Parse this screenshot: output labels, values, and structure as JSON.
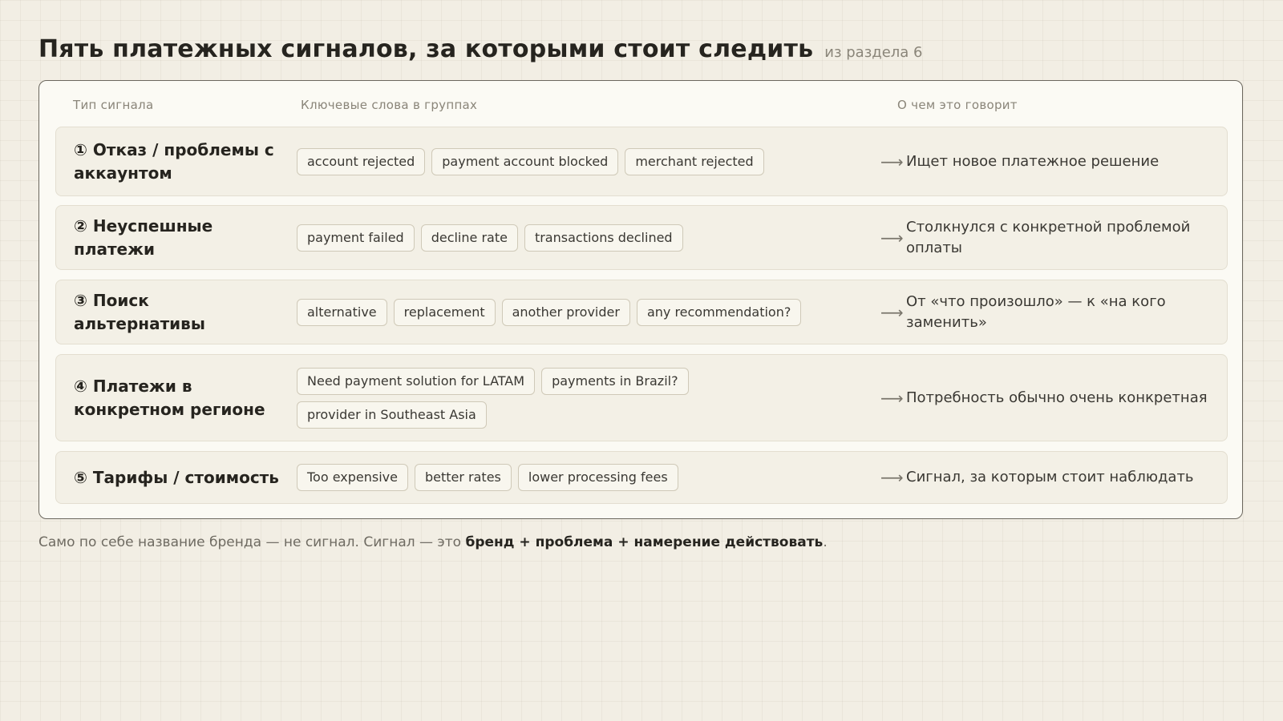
{
  "header": {
    "title": "Пять платежных сигналов, за которыми стоит следить",
    "subtitle": "из раздела 6"
  },
  "table": {
    "columns": [
      "Тип сигнала",
      "Ключевые слова в группах",
      "О чем это говорит"
    ],
    "rows": [
      {
        "type": "① Отказ / проблемы с аккаунтом",
        "keywords": [
          "account rejected",
          "payment account blocked",
          "merchant rejected"
        ],
        "meaning": "Ищет новое платежное решение"
      },
      {
        "type": "② Неуспешные платежи",
        "keywords": [
          "payment failed",
          "decline rate",
          "transactions declined"
        ],
        "meaning": "Столкнулся с конкретной проблемой оплаты"
      },
      {
        "type": "③ Поиск альтернативы",
        "keywords": [
          "alternative",
          "replacement",
          "another provider",
          "any recommendation?"
        ],
        "meaning": "От «что произошло» — к «на кого заменить»"
      },
      {
        "type": "④ Платежи в конкретном регионе",
        "keywords": [
          "Need payment solution for LATAM",
          "payments in Brazil?",
          "provider in Southeast Asia"
        ],
        "meaning": "Потребность обычно очень конкретная"
      },
      {
        "type": "⑤ Тарифы / стоимость",
        "keywords": [
          "Too expensive",
          "better rates",
          "lower processing fees"
        ],
        "meaning": "Сигнал, за которым стоит наблюдать"
      }
    ]
  },
  "arrow_glyph": "⟶",
  "footnote": {
    "plain": "Само по себе название бренда — не сигнал. Сигнал — это ",
    "bold": "бренд + проблема + намерение действовать",
    "end": "."
  }
}
